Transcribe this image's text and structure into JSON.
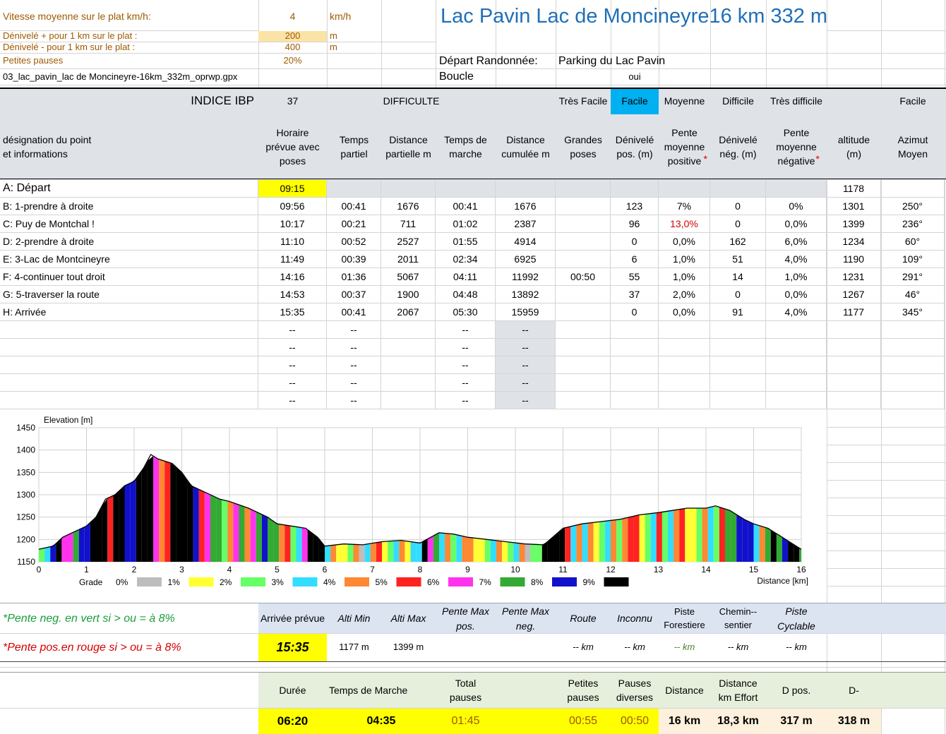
{
  "params": {
    "speed_label": "Vitesse moyenne sur le plat  km/h:",
    "speed_value": "4",
    "speed_unit": "km/h",
    "dplus_label": "Dénivelé + pour 1 km sur le plat :",
    "dplus_value": "200",
    "dplus_unit": "m",
    "dminus_label": "Dénivelé - pour 1 km sur le plat :",
    "dminus_value": "400",
    "dminus_unit": "m",
    "pauses_label": "Petites pauses",
    "pauses_value": "20%",
    "file_name": "03_lac_pavin_lac de Moncineyre-16km_332m_oprwp.gpx"
  },
  "title": "Lac Pavin Lac de Moncineyre16 km 332 m",
  "depart_label": "Départ Randonnée:",
  "depart_value": "Parking du Lac Pavin",
  "boucle_label": "Boucle",
  "boucle_value": "oui",
  "ibp": {
    "label": "INDICE IBP",
    "value": "37",
    "difficulty_label": "DIFFICULTE",
    "levels": [
      "Très Facile",
      "Facile",
      "Moyenne",
      "Difficile",
      "Très difficile"
    ],
    "selected": "Facile",
    "result": "Facile"
  },
  "headers": {
    "designation": "désignation du point\net informations",
    "horaire": "Horaire\nprévue  avec\nposes",
    "temps_partiel": "Temps\npartiel",
    "distance_partielle": "Distance\npartielle m",
    "temps_marche": "Temps de\nmarche",
    "distance_cumulee": "Distance\ncumulée m",
    "grandes_poses": "Grandes\nposes",
    "deniv_pos": "Dénivelé\npos. (m)",
    "pente_pos": "Pente\nmoyenne\npositive",
    "pente_pos_star": "*",
    "deniv_neg": "Dénivelé\nnég. (m)",
    "pente_neg": "Pente\nmoyenne\nnégative",
    "pente_neg_star": "*",
    "altitude": "altitude\n(m)",
    "azimut": "Azimut\nMoyen"
  },
  "rows": [
    {
      "name": "A: Départ",
      "horaire": "09:15",
      "tp": "",
      "dp": "",
      "tm": "",
      "dc": "",
      "gp": "",
      "dpos": "",
      "ppos": "",
      "dneg": "",
      "pneg": "",
      "alt": "1178",
      "az": ""
    },
    {
      "name": "B: 1-prendre à droite",
      "horaire": "09:56",
      "tp": "00:41",
      "dp": "1676",
      "tm": "00:41",
      "dc": "1676",
      "gp": "",
      "dpos": "123",
      "ppos": "7%",
      "dneg": "0",
      "pneg": "0%",
      "alt": "1301",
      "az": "250°"
    },
    {
      "name": "C: Puy de Montchal !",
      "horaire": "10:17",
      "tp": "00:21",
      "dp": "711",
      "tm": "01:02",
      "dc": "2387",
      "gp": "",
      "dpos": "96",
      "ppos": "13,0%",
      "dneg": "0",
      "pneg": "0,0%",
      "alt": "1399",
      "az": "236°"
    },
    {
      "name": "D: 2-prendre à droite",
      "horaire": "11:10",
      "tp": "00:52",
      "dp": "2527",
      "tm": "01:55",
      "dc": "4914",
      "gp": "",
      "dpos": "0",
      "ppos": "0,0%",
      "dneg": "162",
      "pneg": "6,0%",
      "alt": "1234",
      "az": "60°"
    },
    {
      "name": "E: 3-Lac de Montcineyre",
      "horaire": "11:49",
      "tp": "00:39",
      "dp": "2011",
      "tm": "02:34",
      "dc": "6925",
      "gp": "",
      "dpos": "6",
      "ppos": "1,0%",
      "dneg": "51",
      "pneg": "4,0%",
      "alt": "1190",
      "az": "109°"
    },
    {
      "name": "F: 4-continuer tout droit",
      "horaire": "14:16",
      "tp": "01:36",
      "dp": "5067",
      "tm": "04:11",
      "dc": "11992",
      "gp": "00:50",
      "dpos": "55",
      "ppos": "1,0%",
      "dneg": "14",
      "pneg": "1,0%",
      "alt": "1231",
      "az": "291°"
    },
    {
      "name": "G: 5-traverser la route",
      "horaire": "14:53",
      "tp": "00:37",
      "dp": "1900",
      "tm": "04:48",
      "dc": "13892",
      "gp": "",
      "dpos": "37",
      "ppos": "2,0%",
      "dneg": "0",
      "pneg": "0,0%",
      "alt": "1267",
      "az": "46°"
    },
    {
      "name": "H: Arrivée",
      "horaire": "15:35",
      "tp": "00:41",
      "dp": "2067",
      "tm": "05:30",
      "dc": "15959",
      "gp": "",
      "dpos": "0",
      "ppos": "0,0%",
      "dneg": "91",
      "pneg": "4,0%",
      "alt": "1177",
      "az": "345°"
    }
  ],
  "empty_marker": "--",
  "chart_data": {
    "type": "area",
    "ylabel": "Elevation [m]",
    "xlabel": "Distance [km]",
    "xlim": [
      0,
      16
    ],
    "ylim": [
      1150,
      1450
    ],
    "xticks": [
      0,
      1,
      2,
      3,
      4,
      5,
      6,
      7,
      8,
      9,
      10,
      11,
      12,
      13,
      14,
      15,
      16
    ],
    "yticks": [
      1150,
      1200,
      1250,
      1300,
      1350,
      1400,
      1450
    ],
    "grid": true,
    "x": [
      0,
      0.3,
      0.5,
      0.8,
      1,
      1.2,
      1.4,
      1.6,
      1.8,
      2,
      2.2,
      2.35,
      2.5,
      2.8,
      3,
      3.2,
      3.5,
      3.8,
      4,
      4.4,
      4.8,
      5,
      5.3,
      5.6,
      5.85,
      6,
      6.4,
      6.8,
      7.2,
      7.6,
      8,
      8.4,
      8.7,
      9,
      9.4,
      9.8,
      10.2,
      10.6,
      11,
      11.4,
      11.8,
      12.2,
      12.6,
      13,
      13.3,
      13.6,
      14,
      14.2,
      14.5,
      14.8,
      15,
      15.3,
      15.6,
      16
    ],
    "y": [
      1178,
      1185,
      1205,
      1220,
      1230,
      1250,
      1290,
      1300,
      1320,
      1330,
      1360,
      1390,
      1380,
      1370,
      1350,
      1320,
      1305,
      1290,
      1285,
      1270,
      1250,
      1235,
      1230,
      1225,
      1205,
      1185,
      1190,
      1188,
      1195,
      1198,
      1192,
      1215,
      1212,
      1205,
      1200,
      1195,
      1190,
      1188,
      1225,
      1235,
      1240,
      1245,
      1255,
      1260,
      1265,
      1270,
      1270,
      1275,
      1265,
      1245,
      1235,
      1225,
      1205,
      1178
    ],
    "legend_title": "Grade",
    "grade_labels": [
      "0%",
      "1%",
      "2%",
      "3%",
      "4%",
      "5%",
      "6%",
      "7%",
      "8%",
      "9%"
    ],
    "grade_colors": [
      "#bdbdbd",
      "#ffff33",
      "#66ff66",
      "#33ddff",
      "#ff8833",
      "#ff2222",
      "#ff33ee",
      "#33aa33",
      "#1111cc",
      "#000000"
    ]
  },
  "summary1": {
    "note_green": "*Pente neg. en vert si > ou = à 8%",
    "note_red": "*Pente pos.en rouge si > ou = à 8%",
    "h_arrivee": "Arrivée prévue",
    "h_alti_min": "Alti Min",
    "h_alti_max": "Alti Max",
    "h_pente_max_pos": "Pente Max\npos.",
    "h_pente_max_neg": "Pente Max\nneg.",
    "h_route": "Route",
    "h_inconnu": "Inconnu",
    "h_piste_forest": "Piste\nForestiere",
    "h_chemin": "Chemin--\nsentier",
    "h_piste_cycl": "Piste\nCyclable",
    "v_arrivee": "15:35",
    "v_alti_min": "1177 m",
    "v_alti_max": "1399 m",
    "v_route": "-- km",
    "v_inconnu": "-- km",
    "v_piste_forest": "-- km",
    "v_chemin": "-- km",
    "v_piste_cycl": "-- km"
  },
  "summary2": {
    "h_duree": "Durée",
    "h_temps_marche": "Temps de Marche",
    "h_total_pauses": "Total\npauses",
    "h_petites_pauses": "Petites\npauses",
    "h_pauses_diverses": "Pauses\ndiverses",
    "h_distance": "Distance",
    "h_dist_effort": "Distance\nkm Effort",
    "h_dpos": "D pos.",
    "h_dneg": "D-",
    "v_duree": "06:20",
    "v_temps_marche": "04:35",
    "v_total_pauses": "01:45",
    "v_petites_pauses": "00:55",
    "v_pauses_diverses": "00:50",
    "v_distance": "16 km",
    "v_dist_effort": "18,3 km",
    "v_dpos": "317 m",
    "v_dneg": "318 m"
  }
}
